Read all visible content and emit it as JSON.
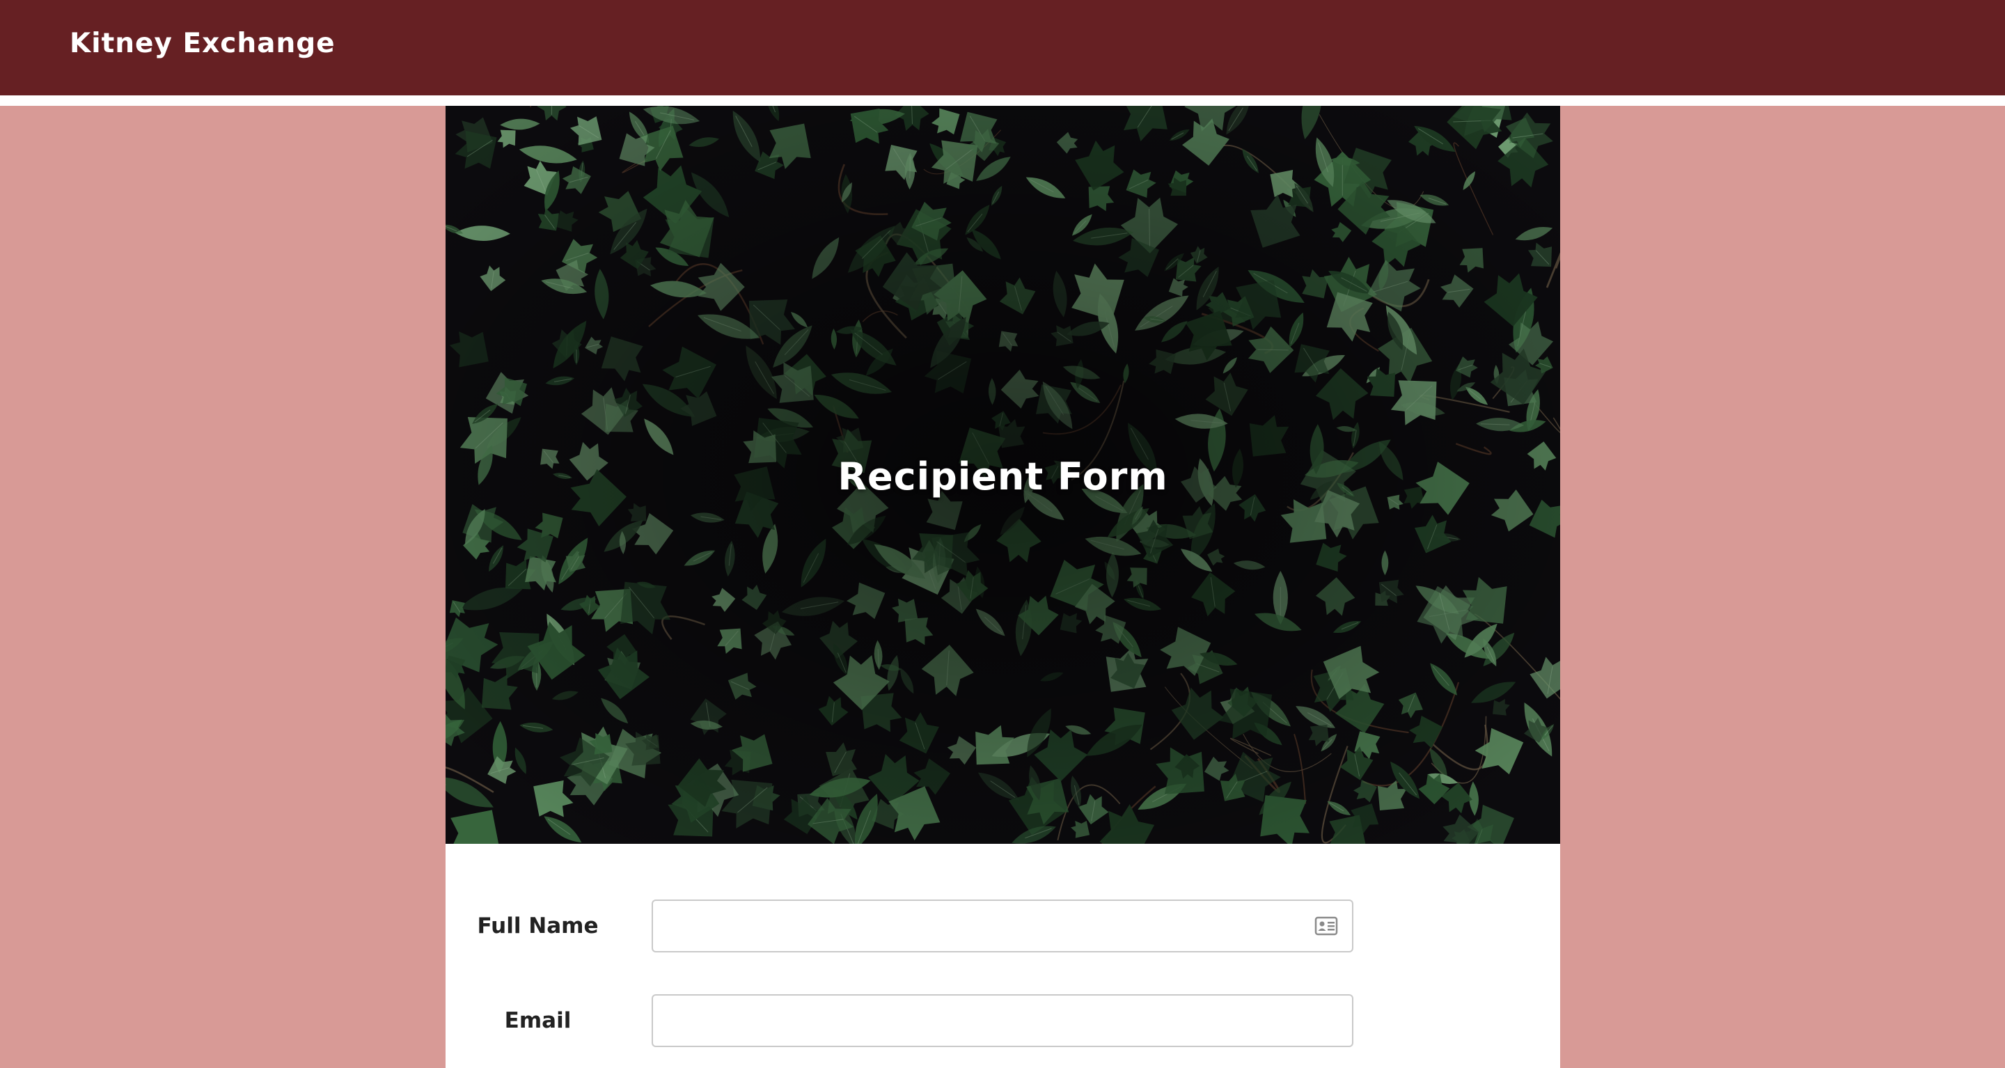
{
  "header": {
    "brand": "Kitney Exchange",
    "background_color": "#662023"
  },
  "page": {
    "background_color": "#d89a96"
  },
  "hero": {
    "title": "Recipient Form",
    "image": "dark ivy leaves"
  },
  "form": {
    "fields": [
      {
        "label": "Full Name",
        "value": "",
        "placeholder": "",
        "icon": "contact-card-icon"
      },
      {
        "label": "Email",
        "value": "",
        "placeholder": ""
      }
    ]
  }
}
